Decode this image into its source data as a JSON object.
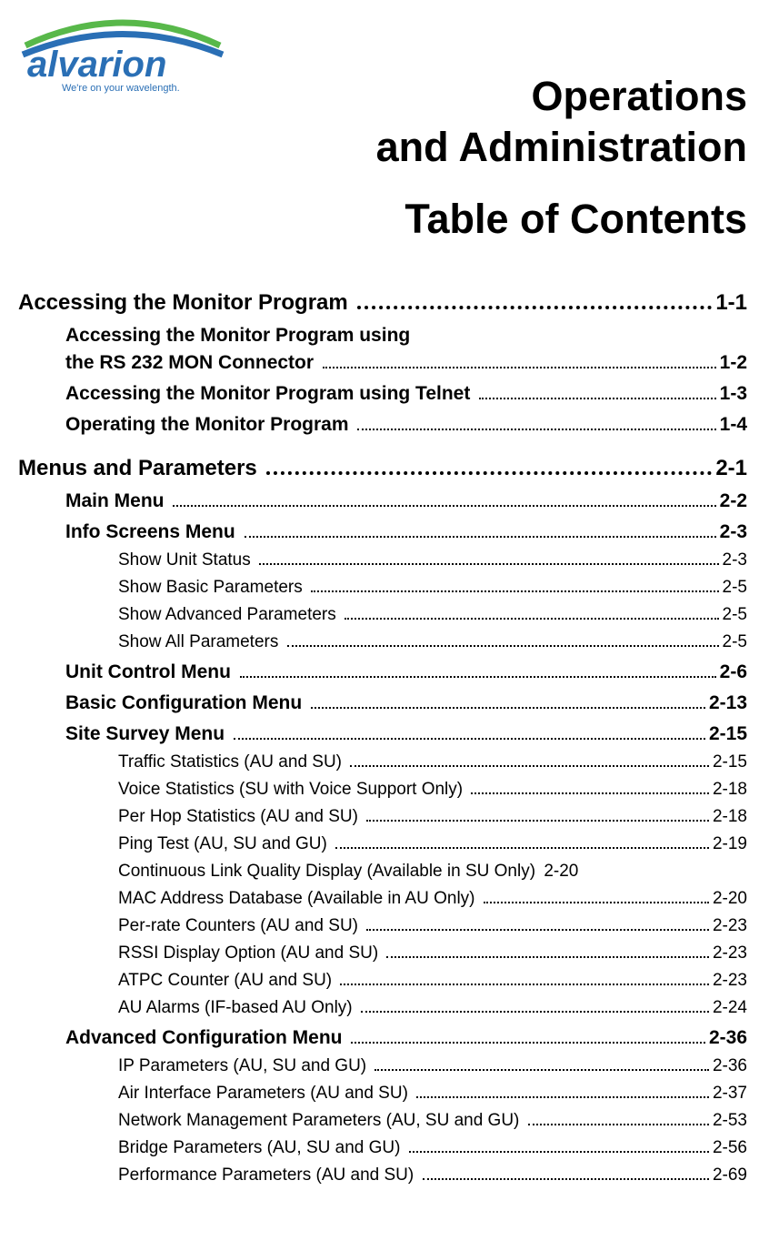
{
  "brand": {
    "name": "alvarion",
    "tagline": "We're on your wavelength."
  },
  "titles": {
    "line1": "Operations",
    "line2": "and Administration",
    "line3": "Table of Contents"
  },
  "toc": {
    "sections": [
      {
        "title": "Accessing the Monitor Program ",
        "page": "1-1",
        "subs1": [
          {
            "title_line1": "Accessing the Monitor Program using",
            "title_line2": "the RS 232 MON Connector ",
            "page": "1-2"
          },
          {
            "title": "Accessing the Monitor Program using Telnet ",
            "page": "1-3"
          },
          {
            "title": "Operating the Monitor Program ",
            "page": "1-4"
          }
        ]
      },
      {
        "title": "Menus and Parameters ",
        "page": "2-1",
        "subs1": [
          {
            "title": "Main Menu ",
            "page": "2-2"
          },
          {
            "title": "Info Screens Menu ",
            "page": "2-3",
            "subs2": [
              {
                "title": "Show Unit Status ",
                "page": "2-3"
              },
              {
                "title": "Show Basic Parameters ",
                "page": "2-5"
              },
              {
                "title": "Show Advanced Parameters ",
                "page": "2-5"
              },
              {
                "title": "Show All Parameters ",
                "page": "2-5"
              }
            ]
          },
          {
            "title": "Unit Control Menu ",
            "page": "2-6"
          },
          {
            "title": "Basic Configuration Menu ",
            "page": "2-13"
          },
          {
            "title": "Site Survey Menu ",
            "page": "2-15",
            "subs2": [
              {
                "title": "Traffic Statistics (AU and SU) ",
                "page": "2-15"
              },
              {
                "title": "Voice Statistics (SU with Voice Support Only) ",
                "page": "2-18"
              },
              {
                "title": "Per Hop Statistics (AU and SU) ",
                "page": "2-18"
              },
              {
                "title": "Ping Test (AU, SU and GU) ",
                "page": "2-19"
              },
              {
                "title": "Continuous Link Quality Display (Available in SU Only) ",
                "page": "2-20",
                "nodots": true
              },
              {
                "title": "MAC Address Database (Available in AU Only) ",
                "page": "2-20"
              },
              {
                "title": "Per-rate Counters (AU and SU) ",
                "page": "2-23"
              },
              {
                "title": "RSSI Display Option (AU and SU) ",
                "page": "2-23"
              },
              {
                "title": "ATPC Counter (AU and SU) ",
                "page": "2-23"
              },
              {
                "title": "AU Alarms (IF-based AU Only) ",
                "page": "2-24"
              }
            ]
          },
          {
            "title": "Advanced Configuration Menu ",
            "page": "2-36",
            "subs2": [
              {
                "title": "IP Parameters (AU, SU and GU) ",
                "page": "2-36"
              },
              {
                "title": "Air Interface Parameters (AU and SU) ",
                "page": "2-37"
              },
              {
                "title": "Network Management Parameters (AU, SU and GU) ",
                "page": "2-53"
              },
              {
                "title": "Bridge Parameters (AU, SU and GU) ",
                "page": "2-56"
              },
              {
                "title": "Performance Parameters (AU and SU) ",
                "page": "2-69"
              }
            ]
          }
        ]
      }
    ]
  }
}
